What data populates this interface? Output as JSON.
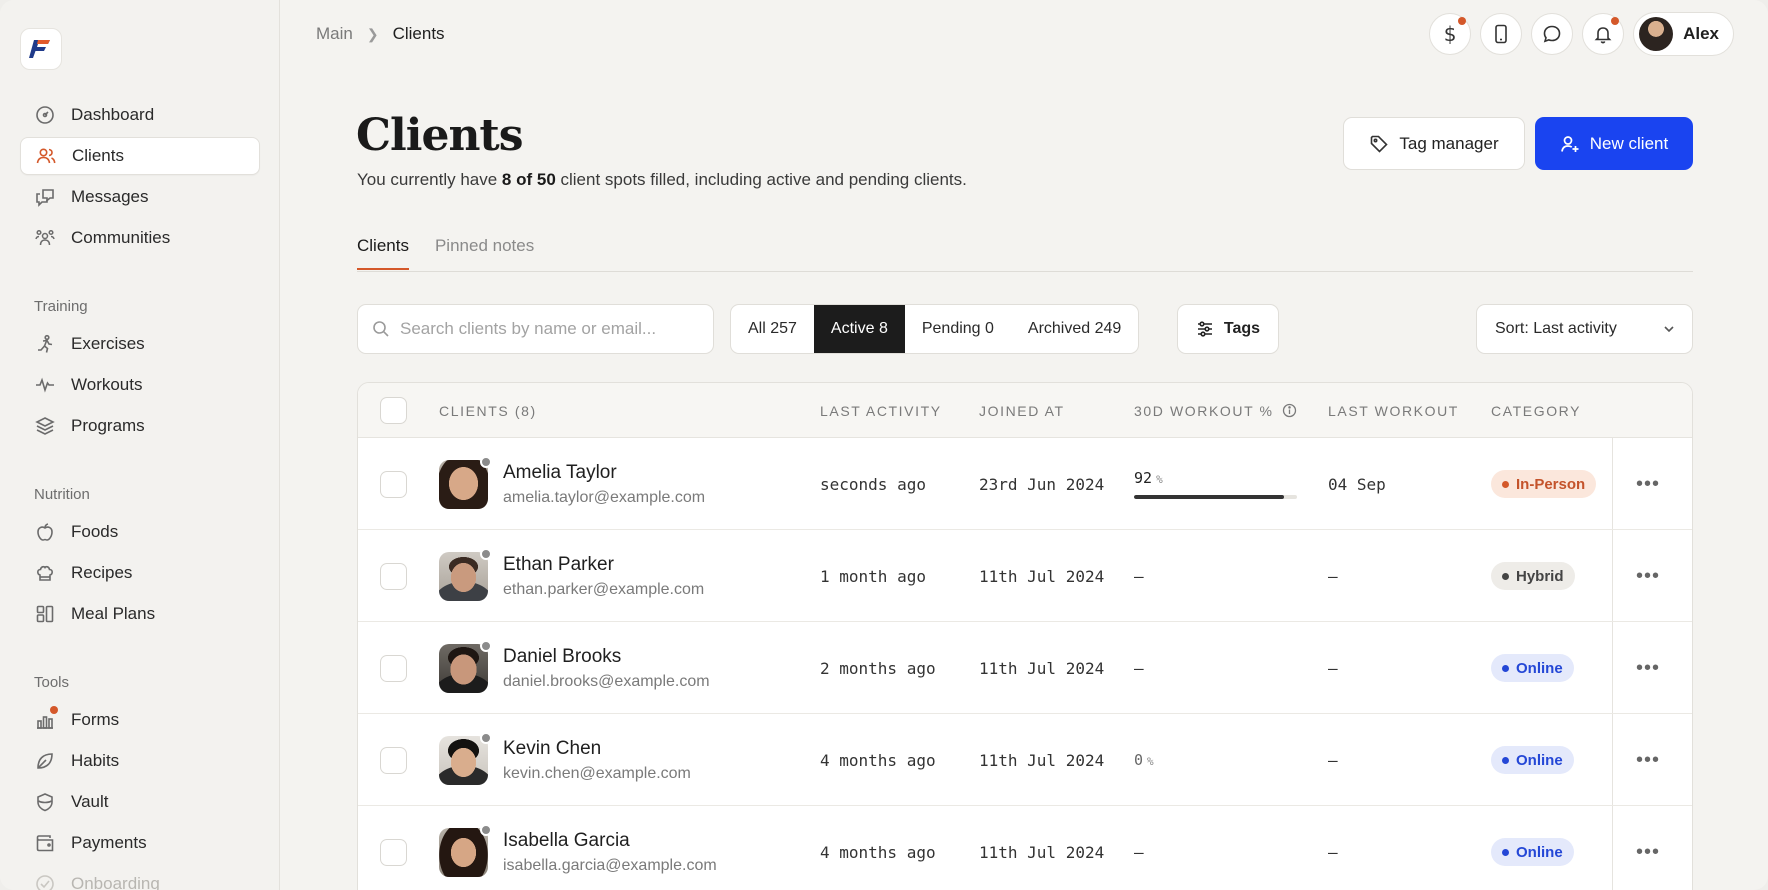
{
  "breadcrumb": {
    "main": "Main",
    "current": "Clients"
  },
  "user": {
    "name": "Alex"
  },
  "sidebar": {
    "items": [
      {
        "label": "Dashboard",
        "icon": "dashboard-icon"
      },
      {
        "label": "Clients",
        "icon": "users-icon",
        "active": true
      },
      {
        "label": "Messages",
        "icon": "messages-icon"
      },
      {
        "label": "Communities",
        "icon": "communities-icon"
      }
    ],
    "sections": [
      {
        "title": "Training",
        "items": [
          {
            "label": "Exercises"
          },
          {
            "label": "Workouts"
          },
          {
            "label": "Programs"
          }
        ]
      },
      {
        "title": "Nutrition",
        "items": [
          {
            "label": "Foods"
          },
          {
            "label": "Recipes"
          },
          {
            "label": "Meal Plans"
          }
        ]
      },
      {
        "title": "Tools",
        "items": [
          {
            "label": "Forms"
          },
          {
            "label": "Habits"
          },
          {
            "label": "Vault"
          },
          {
            "label": "Payments"
          },
          {
            "label": "Onboarding"
          }
        ]
      }
    ]
  },
  "header": {
    "title": "Clients",
    "subtitle_pre": "You currently have ",
    "subtitle_bold": "8 of 50",
    "subtitle_post": " client spots filled, including active and pending clients.",
    "tag_manager_label": "Tag manager",
    "new_client_label": "New client"
  },
  "tabs": [
    {
      "label": "Clients",
      "active": true
    },
    {
      "label": "Pinned notes"
    }
  ],
  "filters": {
    "search_placeholder": "Search clients by name or email...",
    "segments": [
      {
        "label": "All 257"
      },
      {
        "label": "Active 8",
        "active": true
      },
      {
        "label": "Pending 0"
      },
      {
        "label": "Archived 249"
      }
    ],
    "tags_label": "Tags",
    "sort_label": "Sort: Last activity"
  },
  "table": {
    "headers": {
      "clients": "CLIENTS (8)",
      "last_activity": "LAST ACTIVITY",
      "joined_at": "JOINED AT",
      "workout_pct": "30D WORKOUT %",
      "last_workout": "LAST WORKOUT",
      "category": "CATEGORY"
    },
    "rows": [
      {
        "name": "Amelia Taylor",
        "email": "amelia.taylor@example.com",
        "last_activity": "seconds ago",
        "joined": "23rd Jun 2024",
        "pct": "92",
        "pct_unit": "%",
        "pct_value": 92,
        "last_workout": "04 Sep",
        "category": "In-Person"
      },
      {
        "name": "Ethan Parker",
        "email": "ethan.parker@example.com",
        "last_activity": "1 month ago",
        "joined": "11th Jul 2024",
        "pct": "–",
        "last_workout": "–",
        "category": "Hybrid"
      },
      {
        "name": "Daniel Brooks",
        "email": "daniel.brooks@example.com",
        "last_activity": "2 months ago",
        "joined": "11th Jul 2024",
        "pct": "–",
        "last_workout": "–",
        "category": "Online"
      },
      {
        "name": "Kevin Chen",
        "email": "kevin.chen@example.com",
        "last_activity": "4 months ago",
        "joined": "11th Jul 2024",
        "pct": "0",
        "pct_unit": "%",
        "last_workout": "–",
        "category": "Online"
      },
      {
        "name": "Isabella Garcia",
        "email": "isabella.garcia@example.com",
        "last_activity": "4 months ago",
        "joined": "11th Jul 2024",
        "pct": "–",
        "last_workout": "–",
        "category": "Online"
      }
    ]
  },
  "colors": {
    "accent": "#d4582a",
    "primary_button": "#1a44f0",
    "in_person_bg": "#fbe7dc",
    "in_person_fg": "#c4532b",
    "hybrid_bg": "#eeece8",
    "hybrid_fg": "#444444",
    "online_bg": "#e4e9fb",
    "online_fg": "#2447d6"
  }
}
